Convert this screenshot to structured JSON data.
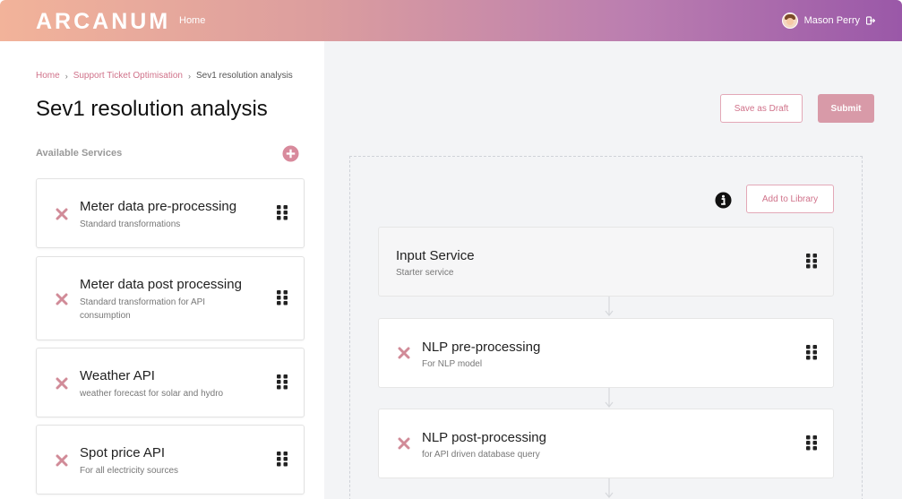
{
  "header": {
    "logo": "ARCANUM",
    "nav_home": "Home",
    "user_name": "Mason Perry"
  },
  "breadcrumb": {
    "home": "Home",
    "project": "Support Ticket Optimisation",
    "current": "Sev1 resolution analysis"
  },
  "page_title": "Sev1 resolution analysis",
  "available_services": {
    "label": "Available Services",
    "items": [
      {
        "title": "Meter data pre-processing",
        "subtitle": "Standard transformations"
      },
      {
        "title": "Meter data post processing",
        "subtitle": "Standard transformation for API consumption"
      },
      {
        "title": "Weather API",
        "subtitle": "weather forecast for solar and hydro"
      },
      {
        "title": "Spot price API",
        "subtitle": "For all electricity sources"
      }
    ]
  },
  "actions": {
    "save_draft": "Save as Draft",
    "submit": "Submit",
    "add_to_library": "Add to Library"
  },
  "pipeline": [
    {
      "title": "Input Service",
      "subtitle": "Starter service",
      "removable": false
    },
    {
      "title": "NLP pre-processing",
      "subtitle": "For NLP model",
      "removable": true
    },
    {
      "title": "NLP post-processing",
      "subtitle": "for API driven database query",
      "removable": true
    }
  ],
  "colors": {
    "accent": "#d0728a",
    "remove_icon": "#d18b98",
    "header_gradient_start": "#f2b39a",
    "header_gradient_end": "#9a58a8"
  },
  "icons": {
    "add": "plus-circle-icon",
    "remove": "x-icon",
    "drag": "grip-icon",
    "info": "info-icon",
    "logout": "logout-icon"
  }
}
